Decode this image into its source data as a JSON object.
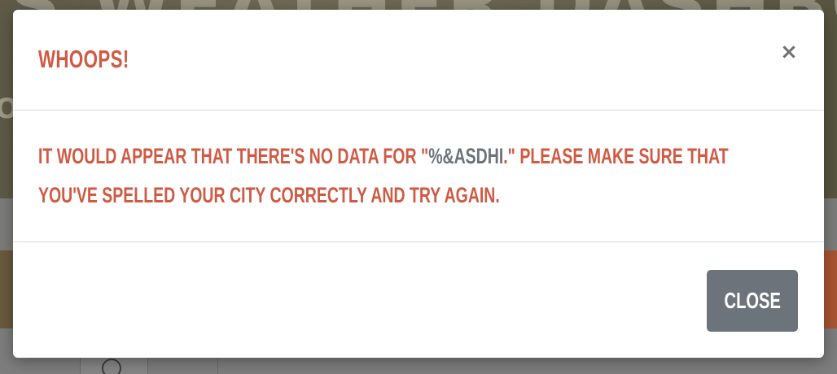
{
  "background": {
    "hero_title": "'S WEATHER DASHBOARD",
    "hero_fragment": "O"
  },
  "modal": {
    "title": "Whoops!",
    "close_icon": "×",
    "message_before": "It would appear that there's no data for \"",
    "city": "%&asdhi",
    "message_after": ".\" Please make sure that you've spelled your city correctly and try again.",
    "close_button_label": "Close"
  },
  "colors": {
    "accent": "#d05a43",
    "city_text": "#6c737a",
    "button_bg": "#6c737b"
  },
  "icons": {
    "close": "close-icon",
    "search_tab": "search-icon"
  }
}
